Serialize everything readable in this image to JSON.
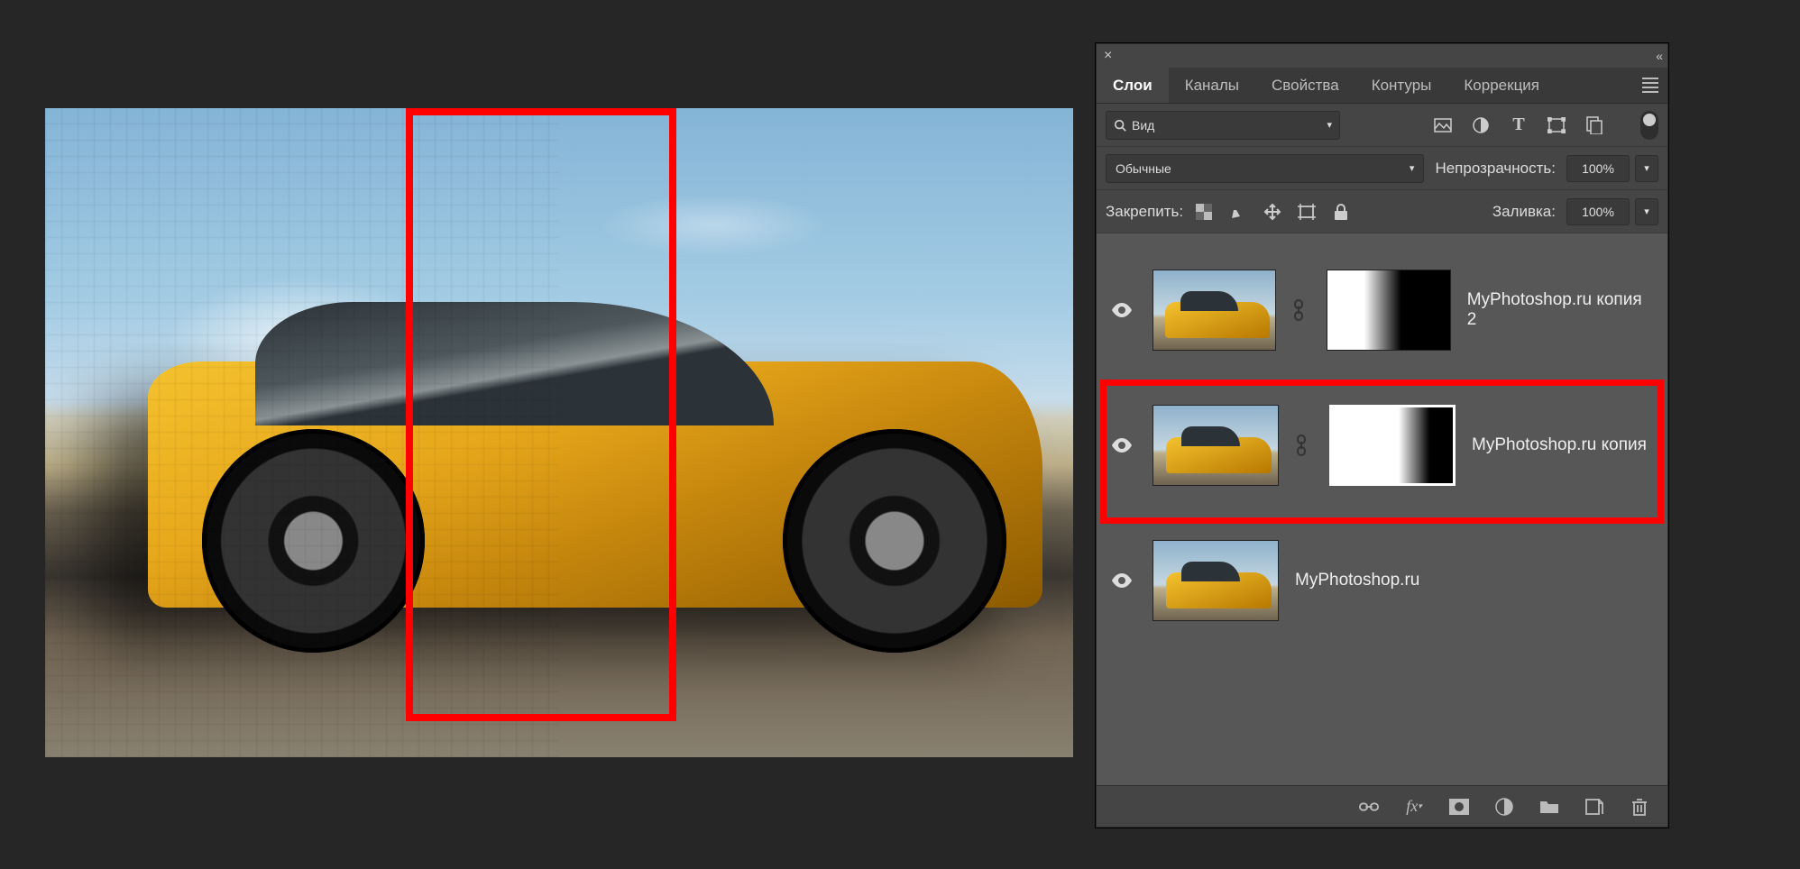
{
  "tabs": {
    "items": [
      "Слои",
      "Каналы",
      "Свойства",
      "Контуры",
      "Коррекция"
    ],
    "activeIndex": 0
  },
  "filterRow": {
    "search_label": "Вид"
  },
  "blendRow": {
    "blend_mode": "Обычные",
    "opacity_label": "Непрозрачность:",
    "opacity_value": "100%"
  },
  "lockRow": {
    "lock_label": "Закрепить:",
    "fill_label": "Заливка:",
    "fill_value": "100%"
  },
  "layers": [
    {
      "name": "MyPhotoshop.ru копия 2",
      "hasMask": true,
      "maskClass": "grad1",
      "selected": false
    },
    {
      "name": "MyPhotoshop.ru копия",
      "hasMask": true,
      "maskClass": "grad2",
      "selected": true
    },
    {
      "name": "MyPhotoshop.ru",
      "hasMask": false,
      "selected": false
    }
  ],
  "footer": {
    "fx_label": "fx"
  }
}
